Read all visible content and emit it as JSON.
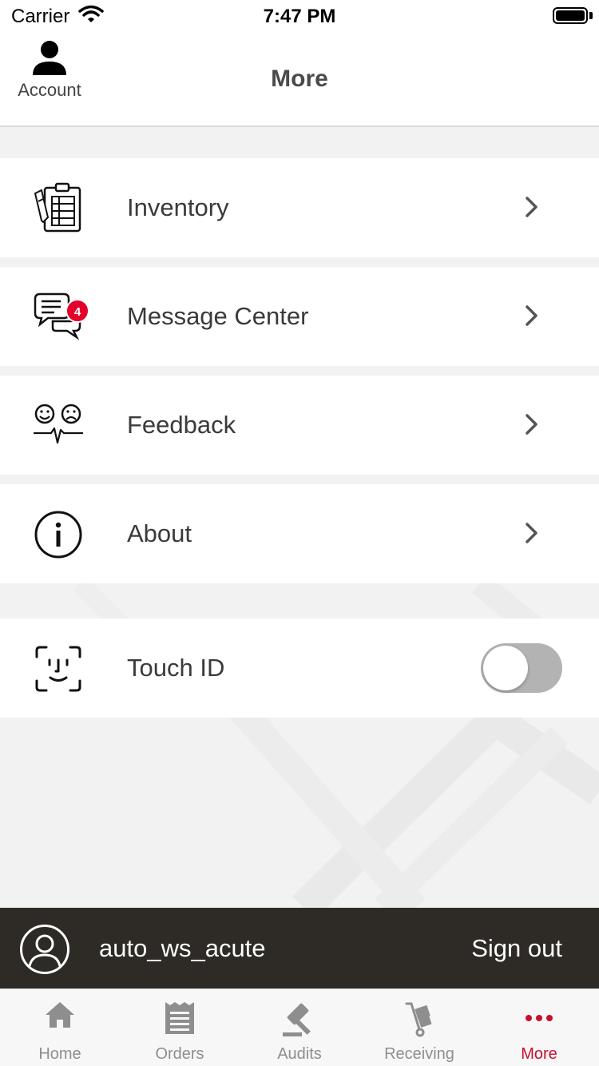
{
  "status_bar": {
    "carrier": "Carrier",
    "time": "7:47 PM"
  },
  "nav": {
    "account_label": "Account",
    "title": "More"
  },
  "menu": {
    "items": [
      {
        "label": "Inventory",
        "icon": "clipboard-checklist-icon"
      },
      {
        "label": "Message Center",
        "icon": "chat-bubbles-icon",
        "badge": "4"
      },
      {
        "label": "Feedback",
        "icon": "smile-frown-faces-icon"
      },
      {
        "label": "About",
        "icon": "info-circle-icon"
      }
    ],
    "touch_id": {
      "label": "Touch ID",
      "icon": "face-scan-icon",
      "enabled": false
    }
  },
  "user_bar": {
    "username": "auto_ws_acute",
    "sign_out_label": "Sign out"
  },
  "tab_bar": {
    "tabs": [
      {
        "label": "Home",
        "icon": "home-icon",
        "active": false
      },
      {
        "label": "Orders",
        "icon": "receipt-icon",
        "active": false
      },
      {
        "label": "Audits",
        "icon": "gavel-icon",
        "active": false
      },
      {
        "label": "Receiving",
        "icon": "hand-truck-icon",
        "active": false
      },
      {
        "label": "More",
        "icon": "more-dots-icon",
        "active": true
      }
    ]
  },
  "colors": {
    "accent": "#c8102e",
    "badge": "#e4002b",
    "user_bar_bg": "#2e2b27",
    "toggle_off": "#b3b3b3"
  }
}
